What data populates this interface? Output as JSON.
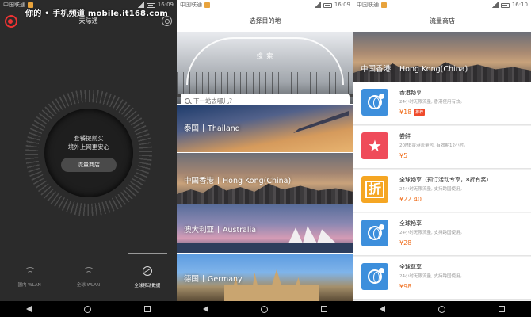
{
  "status": {
    "carrier": "中国联通",
    "time_p1": "16:09",
    "time_p2": "16:09",
    "time_p3": "16:10"
  },
  "watermark": "你的 • 手机频道 mobile.it168.com",
  "screen1": {
    "title": "天际通",
    "dial_line1": "套餐提前买",
    "dial_line2": "境外上网更安心",
    "dial_button": "流量商店",
    "tabs": [
      {
        "label": "国内 WLAN",
        "icon": "wifi-icon"
      },
      {
        "label": "全球 WLAN",
        "icon": "wifi-icon"
      },
      {
        "label": "全球移动数据",
        "icon": "globe-icon",
        "active": true
      }
    ]
  },
  "screen2": {
    "title": "选择目的地",
    "hero_label": "搜 索",
    "search_placeholder": "下一站去哪儿?",
    "destinations": [
      {
        "cn": "泰国",
        "en": "Thailand"
      },
      {
        "cn": "中国香港",
        "en": "Hong Kong(China)"
      },
      {
        "cn": "澳大利亚",
        "en": "Australia"
      },
      {
        "cn": "德国",
        "en": "Germany"
      }
    ]
  },
  "screen3": {
    "title": "流量商店",
    "hero_cn": "中国香港",
    "hero_en": "Hong Kong(China)",
    "packages": [
      {
        "name": "香港畅享",
        "desc": "24小时无限流量, 香港使用有效。",
        "price": "¥18",
        "tag": "推荐",
        "icon": "globe-icon",
        "color": "#3d8fdc"
      },
      {
        "name": "尝鲜",
        "desc": "20MB香港流量包, 有效期12小时。",
        "price": "¥5",
        "icon": "star-icon",
        "color": "#ef4b5a"
      },
      {
        "name": "全球畅享（预订活动专享，8折有奖）",
        "desc": "24小时无限流量, 支持跨国使用。",
        "price": "¥22.40",
        "icon": "discount-icon",
        "color": "#f5a623"
      },
      {
        "name": "全球畅享",
        "desc": "24小时无限流量, 支持跨国使用。",
        "price": "¥28",
        "icon": "globe-icon",
        "color": "#3d8fdc"
      },
      {
        "name": "全球尊享",
        "desc": "24小时无限流量, 支持跨国使用。",
        "price": "¥98",
        "icon": "globe-icon",
        "color": "#3d8fdc"
      }
    ]
  }
}
